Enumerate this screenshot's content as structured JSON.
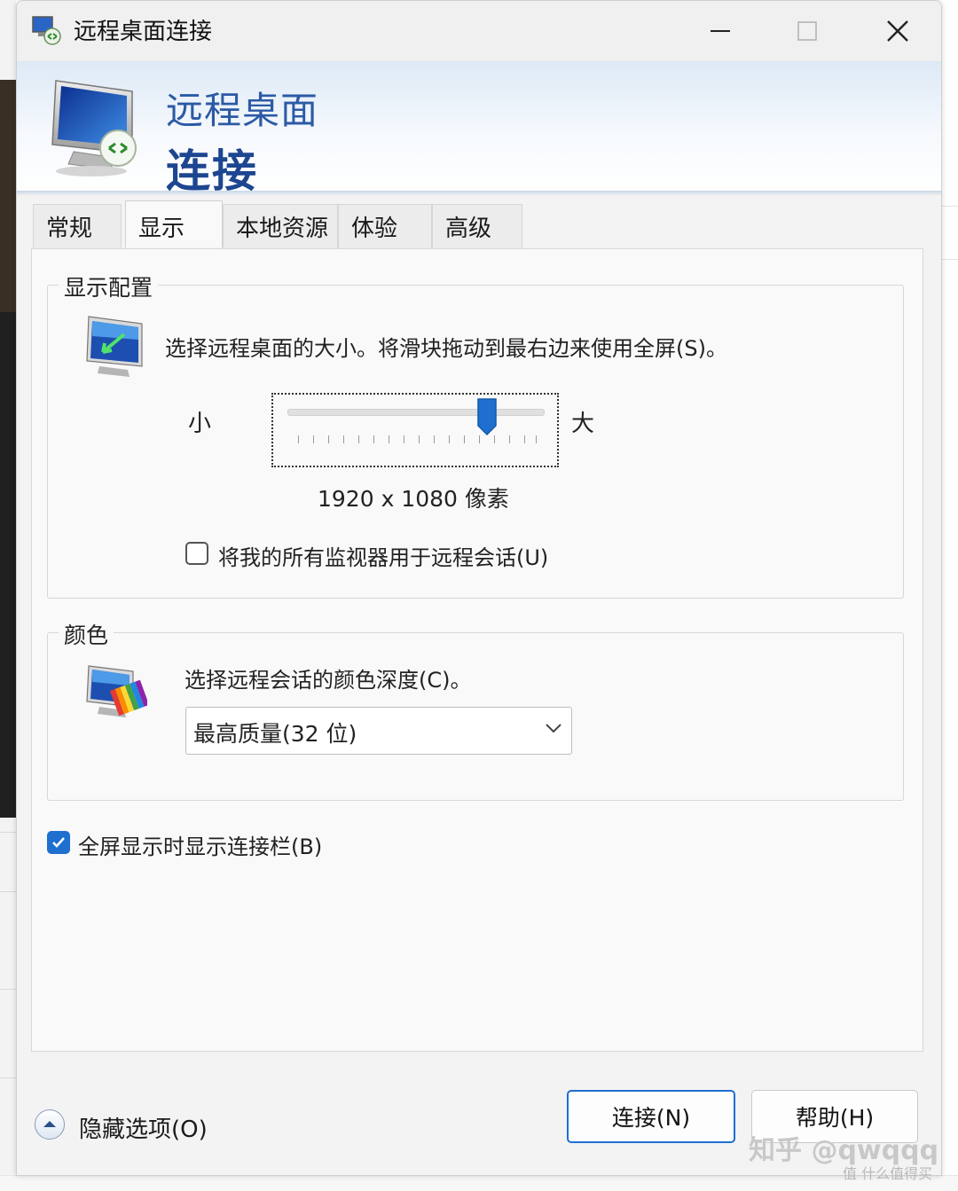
{
  "window": {
    "title": "远程桌面连接",
    "banner_line1": "远程桌面",
    "banner_line2": "连接"
  },
  "tabs": [
    {
      "label": "常规",
      "active": false
    },
    {
      "label": "显示",
      "active": true
    },
    {
      "label": "本地资源",
      "active": false
    },
    {
      "label": "体验",
      "active": false
    },
    {
      "label": "高级",
      "active": false
    }
  ],
  "display_config": {
    "legend": "显示配置",
    "description": "选择远程桌面的大小。将滑块拖动到最右边来使用全屏(S)。",
    "slider_min_label": "小",
    "slider_max_label": "大",
    "slider_value_fraction": 0.77,
    "resolution": "1920 x 1080 像素",
    "multi_monitor_checkbox": {
      "label": "将我的所有监视器用于远程会话(U)",
      "checked": false
    }
  },
  "colors": {
    "legend": "颜色",
    "description": "选择远程会话的颜色深度(C)。",
    "selected": "最高质量(32 位)"
  },
  "connection_bar_checkbox": {
    "label": "全屏显示时显示连接栏(B)",
    "checked": true
  },
  "buttons": {
    "hide_options": "隐藏选项(O)",
    "connect": "连接(N)",
    "help": "帮助(H)"
  },
  "watermark": {
    "main": "知乎 @qwqqq",
    "sub": "值 什么值得买"
  },
  "colors_theme": {
    "accent": "#1e6fd0",
    "banner_title": "#2b5aa5"
  }
}
